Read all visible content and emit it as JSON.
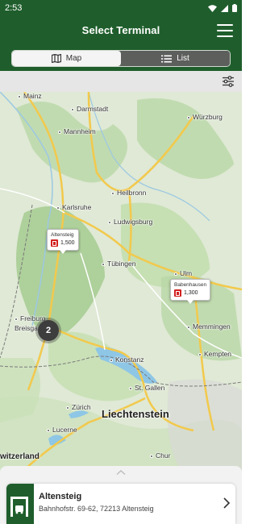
{
  "status_bar": {
    "time": "2:53"
  },
  "app_bar": {
    "title": "Select Terminal"
  },
  "view_toggle": {
    "map_label": "Map",
    "list_label": "List",
    "selected": "Map"
  },
  "map": {
    "cities": [
      {
        "name": "Mainz"
      },
      {
        "name": "Darmstadt"
      },
      {
        "name": "Würzburg"
      },
      {
        "name": "Mannheim"
      },
      {
        "name": "Heilbronn"
      },
      {
        "name": "Karlsruhe"
      },
      {
        "name": "Ludwigsburg"
      },
      {
        "name": "Tübingen"
      },
      {
        "name": "Ulm"
      },
      {
        "name": "Memmingen"
      },
      {
        "name": "Freiburg"
      },
      {
        "name": "Breisgau"
      },
      {
        "name": "Konstanz"
      },
      {
        "name": "Kempten"
      },
      {
        "name": "St. Gallen"
      },
      {
        "name": "Zürich"
      },
      {
        "name": "Lucerne"
      },
      {
        "name": "Chur"
      }
    ],
    "region_label": "Liechtenstein",
    "country_label": "witzerland",
    "markers": [
      {
        "name": "Altensteig",
        "value": "1,500"
      },
      {
        "name": "Babenhausen",
        "value": "1,300"
      }
    ],
    "cluster_count": "2"
  },
  "bottom_card": {
    "title": "Altensteig",
    "address": "Bahnhofstr. 69-62, 72213 Altensteig"
  },
  "colors": {
    "brand_green": "#1f5e2c",
    "fuel_red": "#d32020",
    "cluster_gray": "#3d3d3d"
  }
}
